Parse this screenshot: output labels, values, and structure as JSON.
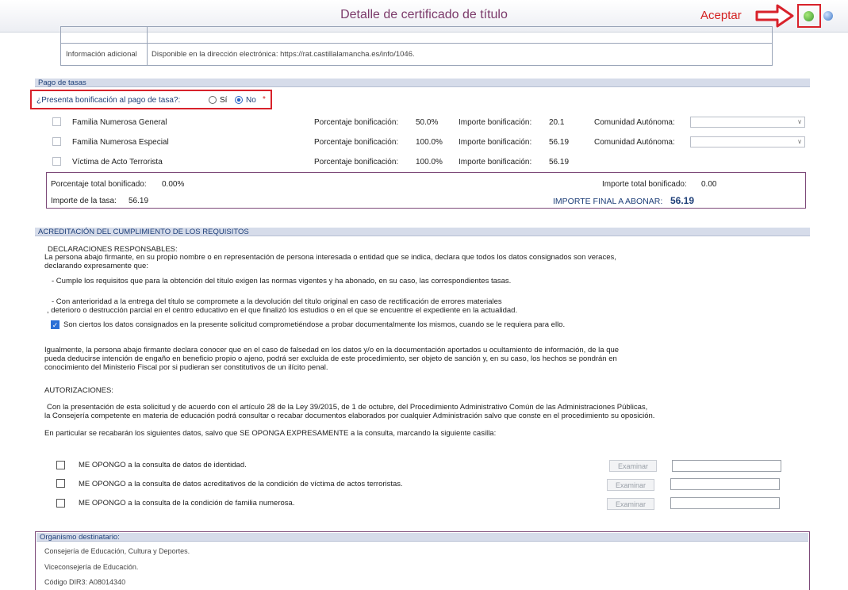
{
  "window": {
    "title": "Detalle de certificado de título",
    "accept_label": "Aceptar",
    "ok_icon": "check-circle-icon",
    "help_icon": "help-circle-icon"
  },
  "info": {
    "label": "Información adicional",
    "value": "Disponible en la dirección electrónica: https://rat.castillalamancha.es/info/1046."
  },
  "pago": {
    "header": "Pago de tasas",
    "question": "¿Presenta bonificación al pago de tasa?:",
    "opt_si": "Sí",
    "opt_no": "No",
    "required_mark": "*",
    "selected": "No",
    "rows": [
      {
        "label": "Familia Numerosa General",
        "pct_label": "Porcentaje bonificación:",
        "pct": "50.0%",
        "imp_label": "Importe bonificación:",
        "imp": "20.1",
        "ca_label": "Comunidad Autónoma:"
      },
      {
        "label": "Familia Numerosa Especial",
        "pct_label": "Porcentaje bonificación:",
        "pct": "100.0%",
        "imp_label": "Importe bonificación:",
        "imp": "56.19",
        "ca_label": "Comunidad Autónoma:"
      },
      {
        "label": "Víctima de Acto Terrorista",
        "pct_label": "Porcentaje bonificación:",
        "pct": "100.0%",
        "imp_label": "Importe bonificación:",
        "imp": "56.19"
      }
    ],
    "totals": {
      "pct_total_label": "Porcentaje total bonificado:",
      "pct_total": "0.00%",
      "imp_total_label": "Importe total bonificado:",
      "imp_total": "0.00",
      "tasa_label": "Importe de la tasa:",
      "tasa": "56.19",
      "final_label": "IMPORTE FINAL A ABONAR:",
      "final": "56.19"
    }
  },
  "acred": {
    "header": "ACREDITACIÓN DEL CUMPLIMIENTO DE LOS REQUISITOS",
    "decl_title": "DECLARACIONES RESPONSABLES:",
    "decl_intro1": "La persona abajo firmante, en su propio nombre o en representación de persona interesada o entidad que se indica, declara que todos los datos consignados son veraces,",
    "decl_intro2": "declarando expresamente que:",
    "decl_item1": "- Cumple los requisitos que para la obtención del título exigen las normas vigentes y ha abonado, en su caso, las correspondientes tasas.",
    "decl_item2a": "- Con anterioridad a la entrega del título se compromete a la devolución del título original en caso de rectificación de errores materiales",
    "decl_item2b": ", deterioro o destrucción parcial en el centro educativo en el que finalizó los estudios o en el que se encuentre el expediente en la actualidad.",
    "check_text": "Son ciertos los datos consignados en la presente solicitud comprometiéndose a probar documentalmente los mismos, cuando se le requiera para ello.",
    "igual1": "Igualmente, la persona abajo firmante declara conocer que en el caso de falsedad en los datos y/o en la documentación aportados u ocultamiento de información, de la que",
    "igual2": "pueda deducirse intención de engaño en beneficio propio o ajeno, podrá ser excluida de este procedimiento, ser objeto de sanción y, en su caso, los hechos se pondrán en",
    "igual3": "conocimiento del Ministerio Fiscal por si pudieran ser constitutivos de un ilícito penal.",
    "auto_title": "AUTORIZACIONES:",
    "auto1": "Con la presentación de esta solicitud y de acuerdo con el artículo 28 de la Ley 39/2015, de 1 de octubre, del Procedimiento Administrativo Común de las Administraciones Públicas,",
    "auto2": "la Consejería competente en materia de educación podrá consultar o recabar documentos elaborados por cualquier Administración salvo que conste en el procedimiento su oposición.",
    "particular": "En particular se recabarán los siguientes datos, salvo que SE OPONGA EXPRESAMENTE a la consulta, marcando la siguiente casilla:",
    "oppose": [
      {
        "text": "ME OPONGO a la consulta de datos de identidad.",
        "button": "Examinar"
      },
      {
        "text": "ME OPONGO a la consulta de  datos acreditativos de la condición de víctima de actos terroristas.",
        "button": "Examinar"
      },
      {
        "text": "ME OPONGO a la consulta de la condición de familia numerosa.",
        "button": "Examinar"
      }
    ]
  },
  "organismo": {
    "header": "Organismo destinatario:",
    "line1": "Consejería de Educación, Cultura y Deportes.",
    "line2": "Viceconsejería de Educación.",
    "line3": "Código DIR3: A08014340"
  }
}
